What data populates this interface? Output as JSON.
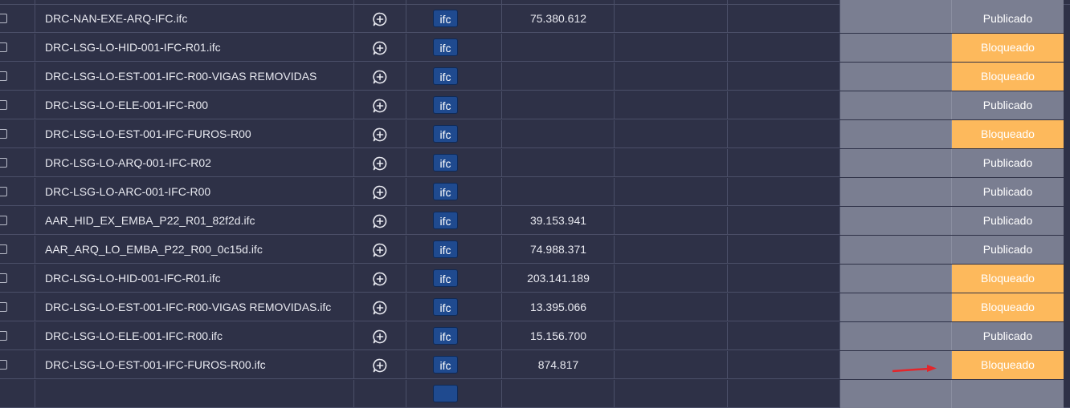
{
  "colors": {
    "row_bg": "#2e3147",
    "publicado_bg": "#7a7e91",
    "bloqueado_bg": "#fdb95c",
    "badge_bg": "#1f4a8f",
    "arrow": "#e3262b"
  },
  "icons": {
    "add_comment": "chat-plus-icon",
    "annotation": "red-arrow-icon"
  },
  "rows": [
    {
      "name": "DRC-NAN-EXE-ARQ-IFC.ifc",
      "type": "ifc",
      "size": "75.380.612",
      "status": "Publicado"
    },
    {
      "name": "DRC-LSG-LO-HID-001-IFC-R01.ifc",
      "type": "ifc",
      "size": "",
      "status": "Bloqueado"
    },
    {
      "name": "DRC-LSG-LO-EST-001-IFC-R00-VIGAS REMOVIDAS",
      "type": "ifc",
      "size": "",
      "status": "Bloqueado"
    },
    {
      "name": "DRC-LSG-LO-ELE-001-IFC-R00",
      "type": "ifc",
      "size": "",
      "status": "Publicado"
    },
    {
      "name": "DRC-LSG-LO-EST-001-IFC-FUROS-R00",
      "type": "ifc",
      "size": "",
      "status": "Bloqueado"
    },
    {
      "name": "DRC-LSG-LO-ARQ-001-IFC-R02",
      "type": "ifc",
      "size": "",
      "status": "Publicado"
    },
    {
      "name": "DRC-LSG-LO-ARC-001-IFC-R00",
      "type": "ifc",
      "size": "",
      "status": "Publicado"
    },
    {
      "name": "AAR_HID_EX_EMBA_P22_R01_82f2d.ifc",
      "type": "ifc",
      "size": "39.153.941",
      "status": "Publicado"
    },
    {
      "name": "AAR_ARQ_LO_EMBA_P22_R00_0c15d.ifc",
      "type": "ifc",
      "size": "74.988.371",
      "status": "Publicado"
    },
    {
      "name": "DRC-LSG-LO-HID-001-IFC-R01.ifc",
      "type": "ifc",
      "size": "203.141.189",
      "status": "Bloqueado"
    },
    {
      "name": "DRC-LSG-LO-EST-001-IFC-R00-VIGAS REMOVIDAS.ifc",
      "type": "ifc",
      "size": "13.395.066",
      "status": "Bloqueado"
    },
    {
      "name": "DRC-LSG-LO-ELE-001-IFC-R00.ifc",
      "type": "ifc",
      "size": "15.156.700",
      "status": "Publicado"
    },
    {
      "name": "DRC-LSG-LO-EST-001-IFC-FUROS-R00.ifc",
      "type": "ifc",
      "size": "874.817",
      "status": "Bloqueado"
    }
  ]
}
